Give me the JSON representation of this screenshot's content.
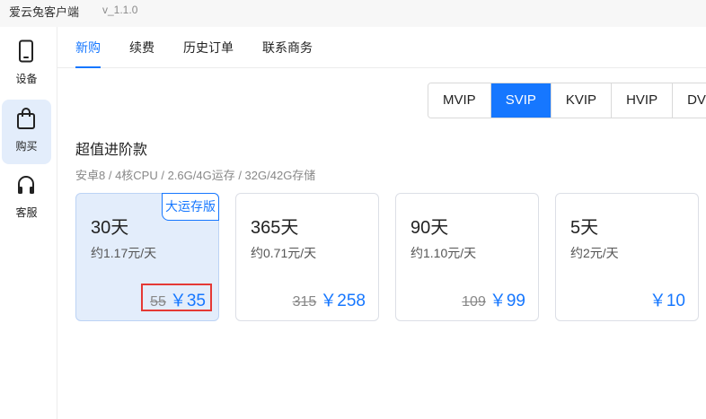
{
  "app": {
    "title": "爱云兔客户端",
    "version": "v_1.1.0"
  },
  "sidebar": {
    "items": [
      {
        "label": "设备",
        "icon": "phone-icon"
      },
      {
        "label": "购买",
        "icon": "shopping-bag-icon"
      },
      {
        "label": "客服",
        "icon": "headphones-icon"
      }
    ],
    "active_index": 1
  },
  "tabs": [
    "新购",
    "续费",
    "历史订单",
    "联系商务"
  ],
  "active_tab_index": 0,
  "vip_levels": [
    "MVIP",
    "SVIP",
    "KVIP",
    "HVIP",
    "DVIP"
  ],
  "active_vip_index": 1,
  "section": {
    "title": "超值进阶款",
    "spec": "安卓8 / 4核CPU / 2.6G/4G运存 / 32G/42G存储"
  },
  "plans": [
    {
      "days": "30天",
      "daily": "约1.17元/天",
      "original": "55",
      "price": "￥35",
      "badge": "大运存版"
    },
    {
      "days": "365天",
      "daily": "约0.71元/天",
      "original": "315",
      "price": "￥258"
    },
    {
      "days": "90天",
      "daily": "约1.10元/天",
      "original": "109",
      "price": "￥99"
    },
    {
      "days": "5天",
      "daily": "约2元/天",
      "price": "￥10"
    }
  ],
  "active_plan_index": 0,
  "colors": {
    "accent": "#1677ff",
    "active_bg": "#e3edfb",
    "highlight": "#e53935"
  }
}
